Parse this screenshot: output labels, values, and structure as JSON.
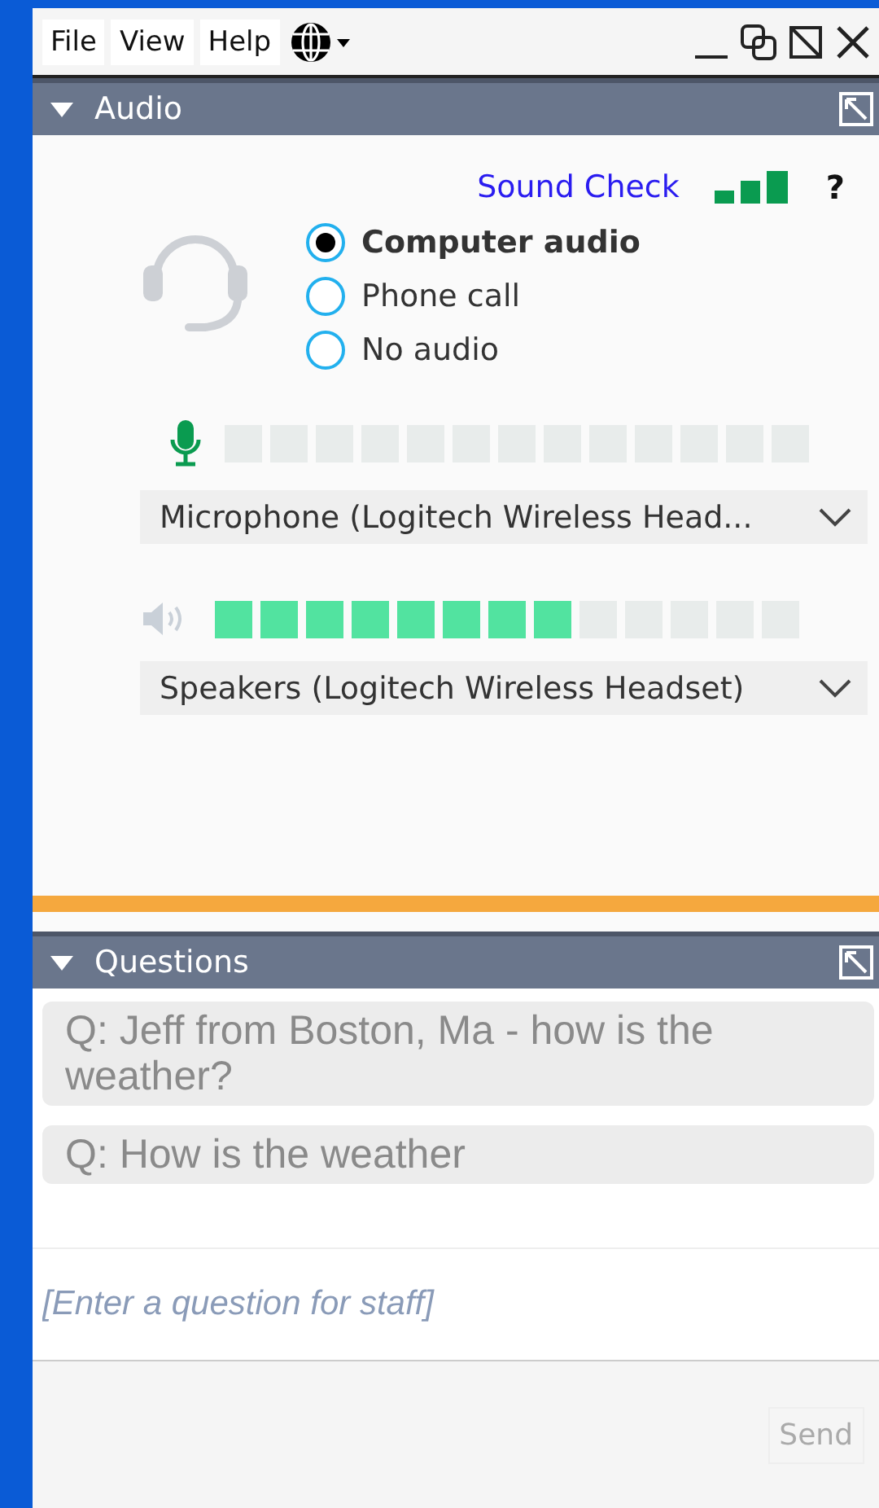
{
  "menu": [
    "File",
    "View",
    "Help"
  ],
  "audio_panel": {
    "title": "Audio",
    "expanded": true,
    "sound_check": "Sound Check",
    "help": "?",
    "options": [
      {
        "label": "Computer audio",
        "selected": true
      },
      {
        "label": "Phone call",
        "selected": false
      },
      {
        "label": "No audio",
        "selected": false
      }
    ],
    "microphone": {
      "device": "Microphone  (Logitech  Wireless  Head..."
    },
    "speakers": {
      "level": 0.615,
      "device": "Speakers (Logitech Wireless Headset)"
    }
  },
  "questions_panel": {
    "title": "Questions",
    "expanded": true,
    "questions": [
      "Q: Jeff from Boston, Ma - how is the weather?",
      "Q: How is the weather"
    ],
    "input": {
      "placeholder": "[Enter a question for staff]"
    },
    "send": {
      "label": "Send",
      "disabled": true
    }
  }
}
